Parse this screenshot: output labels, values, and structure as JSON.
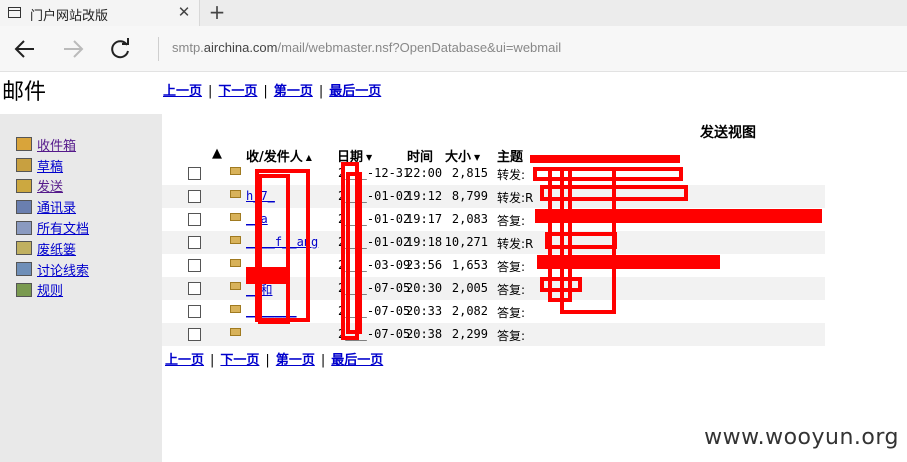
{
  "browser": {
    "tab_title": "门户网站改版",
    "close_glyph": "✕",
    "new_tab_glyph": "+",
    "url_prefix": "smtp.",
    "url_host": "airchina.com",
    "url_rest": "/mail/webmaster.nsf?OpenDatabase&ui=webmail",
    "back_icon": "arrow-left-icon",
    "forward_icon": "arrow-right-icon",
    "refresh_icon": "refresh-icon"
  },
  "page": {
    "title": "邮件",
    "view_title": "发送视图",
    "watermark": "www.wooyun.org"
  },
  "sidebar": {
    "items": [
      {
        "label": "收件箱",
        "icon": "inbox-icon",
        "visited": true
      },
      {
        "label": "草稿",
        "icon": "draft-icon",
        "visited": false
      },
      {
        "label": "发送",
        "icon": "sent-icon",
        "visited": true
      },
      {
        "label": "通讯录",
        "icon": "address-book-icon",
        "visited": false
      },
      {
        "label": "所有文档",
        "icon": "all-docs-icon",
        "visited": false
      },
      {
        "label": "废纸篓",
        "icon": "trash-icon",
        "visited": false
      },
      {
        "label": "讨论线索",
        "icon": "thread-icon",
        "visited": false
      },
      {
        "label": "规则",
        "icon": "rules-icon",
        "visited": false
      }
    ]
  },
  "pager": {
    "prev": "上一页",
    "next": "下一页",
    "first": "第一页",
    "last": "最后一页",
    "sep": "|"
  },
  "columns": {
    "sort_marker": "▲",
    "sender": "收/发件人",
    "sender_arrow": "▲",
    "date": "日期",
    "date_arrow": "▼",
    "time": "时间",
    "size": "大小",
    "size_arrow": "▼",
    "subject": "主题"
  },
  "rows": [
    {
      "sender": "",
      "date": "2___-12-31",
      "time": "22:00",
      "size": "2,815",
      "subject": "转发:"
    },
    {
      "sender": "h_7_",
      "date": "2___-01-02",
      "time": "19:12",
      "size": "8,799",
      "subject": "转发:R"
    },
    {
      "sender": "__a",
      "date": "2___-01-02",
      "time": "19:17",
      "size": "2,083",
      "subject": "答复:"
    },
    {
      "sender": "____f__ang",
      "date": "2___-01-02",
      "time": "19:18",
      "size": "10,271",
      "subject": "转发:R"
    },
    {
      "sender": "",
      "date": "2___-03-09",
      "time": "23:56",
      "size": "1,653",
      "subject": "答复:"
    },
    {
      "sender": "__和",
      "date": "2___-07-05",
      "time": "20:30",
      "size": "2,005",
      "subject": "答复:"
    },
    {
      "sender": "_______",
      "date": "2___-07-05",
      "time": "20:33",
      "size": "2,082",
      "subject": "答复:"
    },
    {
      "sender": "",
      "date": "2___-07-05",
      "time": "20:38",
      "size": "2,299",
      "subject": "答复:"
    }
  ],
  "colors": {
    "link": "#0000cc",
    "visited": "#551a8b",
    "redaction": "#ff0000",
    "sidebar_bg": "#e9e9e9",
    "alt_row": "#f2f2f2"
  }
}
